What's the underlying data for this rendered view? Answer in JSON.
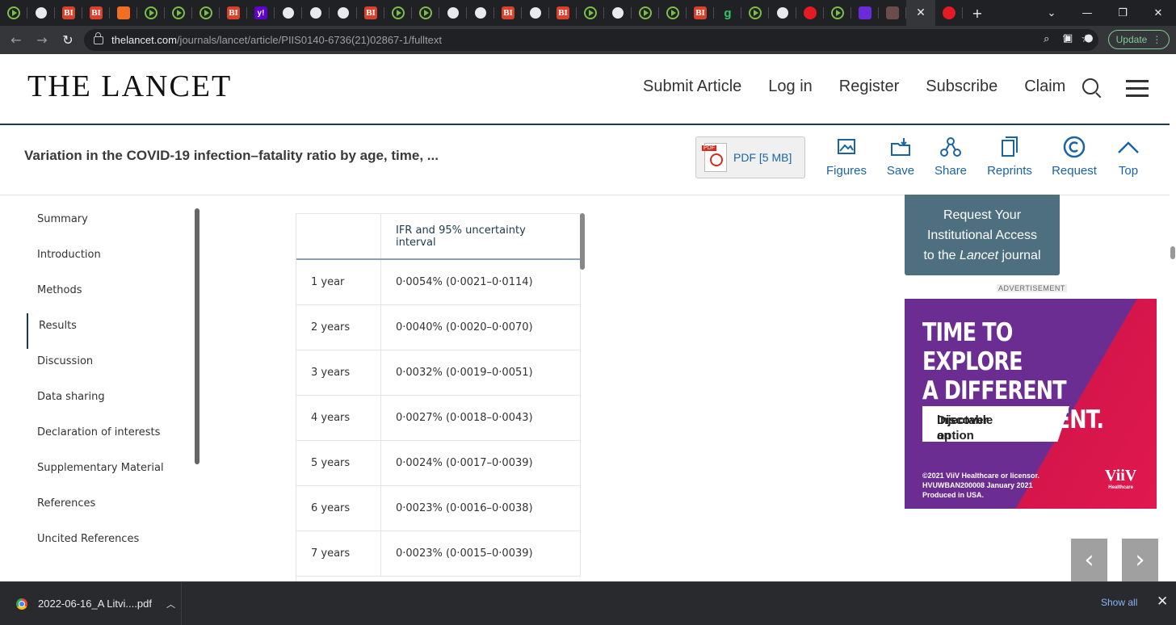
{
  "browser": {
    "url_host": "thelancet.com",
    "url_path": "/journals/lancet/article/PIIS0140-6736(21)02867-1/fulltext",
    "update_label": "Update",
    "tab_favicons": [
      "play",
      "globe",
      "BI",
      "BI",
      "book",
      "play",
      "play",
      "play",
      "BI",
      "y!",
      "globe",
      "globe",
      "globe",
      "BI",
      "play",
      "play",
      "globe",
      "globe",
      "BI",
      "globe",
      "BI",
      "play",
      "globe",
      "play",
      "play",
      "BI",
      "g",
      "play",
      "globe",
      "red",
      "play",
      "mail",
      "photo"
    ]
  },
  "site": {
    "logo": "THE LANCET",
    "nav": [
      "Submit Article",
      "Log in",
      "Register",
      "Subscribe",
      "Claim"
    ]
  },
  "article_bar": {
    "title": "Variation in the COVID-19 infection–fatality ratio by age, time, ...",
    "pdf_label": "PDF [5 MB]",
    "tools": [
      "Figures",
      "Save",
      "Share",
      "Reprints",
      "Request",
      "Top"
    ]
  },
  "toc": {
    "items": [
      "Summary",
      "Introduction",
      "Methods",
      "Results",
      "Discussion",
      "Data sharing",
      "Declaration of interests",
      "Supplementary Material",
      "References",
      "Uncited References"
    ],
    "active": "Results"
  },
  "table": {
    "header_age": "",
    "header_ifr": "IFR and 95% uncertainty interval",
    "rows": [
      {
        "age": "1 year",
        "ifr": "0·0054% (0·0021–0·0114)"
      },
      {
        "age": "2 years",
        "ifr": "0·0040% (0·0020–0·0070)"
      },
      {
        "age": "3 years",
        "ifr": "0·0032% (0·0019–0·0051)"
      },
      {
        "age": "4 years",
        "ifr": "0·0027% (0·0018–0·0043)"
      },
      {
        "age": "5 years",
        "ifr": "0·0024% (0·0017–0·0039)"
      },
      {
        "age": "6 years",
        "ifr": "0·0023% (0·0016–0·0038)"
      },
      {
        "age": "7 years",
        "ifr": "0·0023% (0·0015–0·0039)"
      }
    ]
  },
  "sidebar": {
    "institutional_line1": "Request Your",
    "institutional_line2": "Institutional Access",
    "institutional_line3_pre": "to the ",
    "institutional_line3_em": "Lancet",
    "institutional_line3_post": " journal",
    "ad_label": "ADVERTISEMENT",
    "ad_headline_1": "TIME TO EXPLORE",
    "ad_headline_2": "A DIFFERENT",
    "ad_headline_3": "HIV TREATMENT.",
    "ad_cta_1": "Discover an",
    "ad_cta_2": "injectable option",
    "ad_fine_1": "©2021 ViiV Healthcare or licensor.",
    "ad_fine_2": "HVUWBAN200008 January 2021",
    "ad_fine_3": "Produced in USA.",
    "ad_logo": "ViiV",
    "ad_logo_sub": "Healthcare",
    "colors": {
      "ad_purple": "#6b2d91",
      "ad_pink": "#d5164b",
      "inst_bg": "#4e6f80"
    }
  },
  "downloads": {
    "file": "2022-06-16_A Litvi....pdf",
    "show_all": "Show all"
  }
}
